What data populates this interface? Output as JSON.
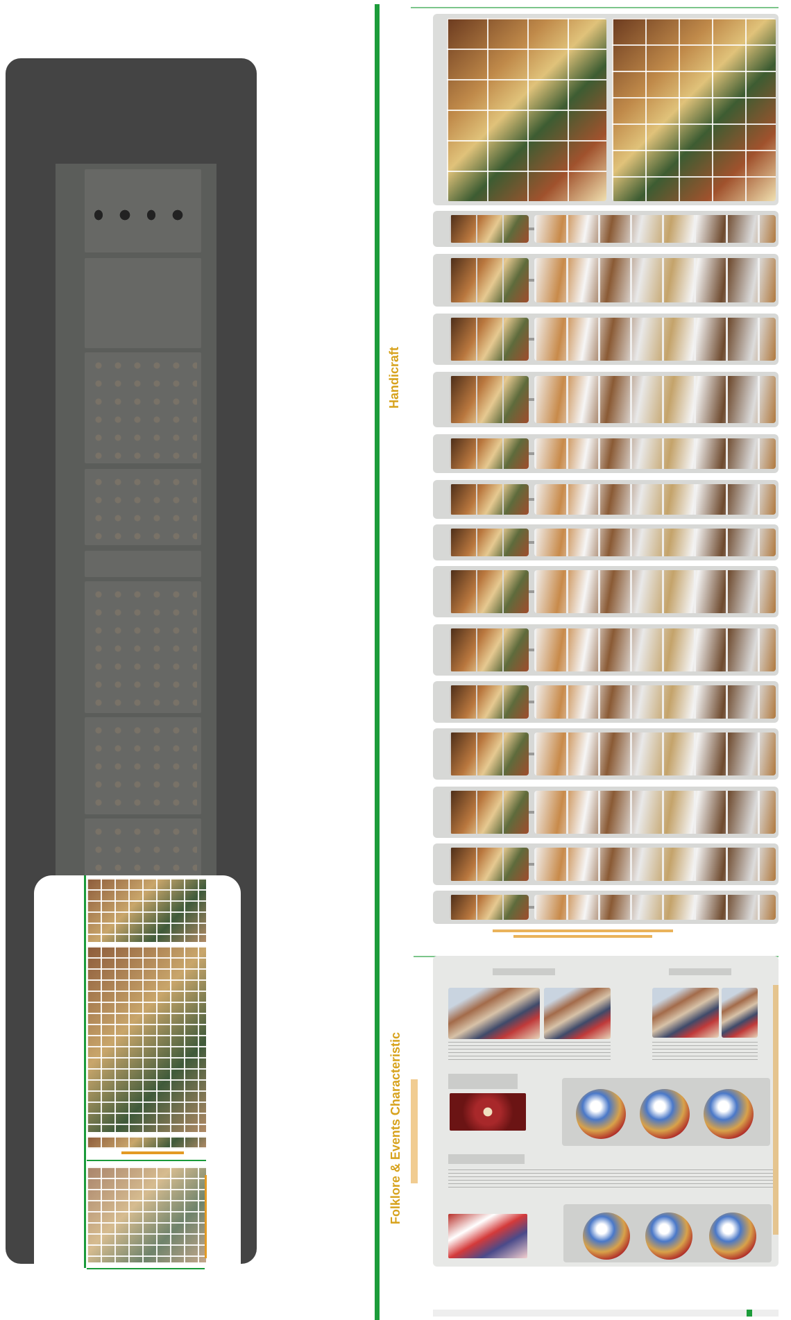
{
  "main": {
    "handicraft_label": "Handicraft",
    "folklore_label": "Folklore & Events Characteristic",
    "colors": {
      "green": "#1c9c3a",
      "gold": "#d7a21c",
      "orange": "#e39a24",
      "navigator_bg": "#444444"
    }
  }
}
